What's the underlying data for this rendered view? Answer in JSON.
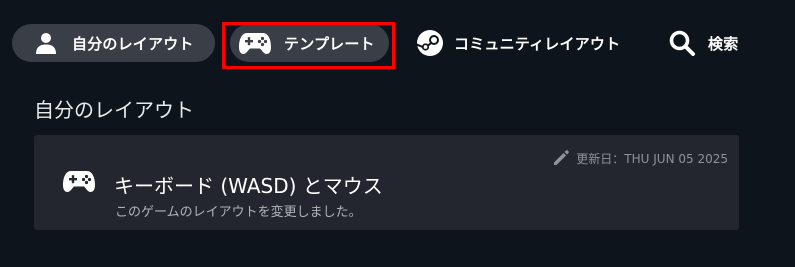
{
  "tabs": {
    "mine": {
      "label": "自分のレイアウト",
      "icon": "person-icon"
    },
    "templates": {
      "label": "テンプレート",
      "icon": "gamepad-icon"
    },
    "community": {
      "label": "コミュニティレイアウト",
      "icon": "steam-icon"
    },
    "search": {
      "label": "検索",
      "icon": "search-icon"
    }
  },
  "section": {
    "title": "自分のレイアウト"
  },
  "layout_card": {
    "updated": "更新日：THU JUN 05 2025",
    "title": "キーボード (WASD) とマウス",
    "description": "このゲームのレイアウトを変更しました。",
    "icons": [
      "edit-icon",
      "gamepad-icon"
    ]
  },
  "colors": {
    "background": "#0e141b",
    "tab_background": "#3a3f47",
    "card_background": "#23262e",
    "highlight": "#ff0000"
  }
}
